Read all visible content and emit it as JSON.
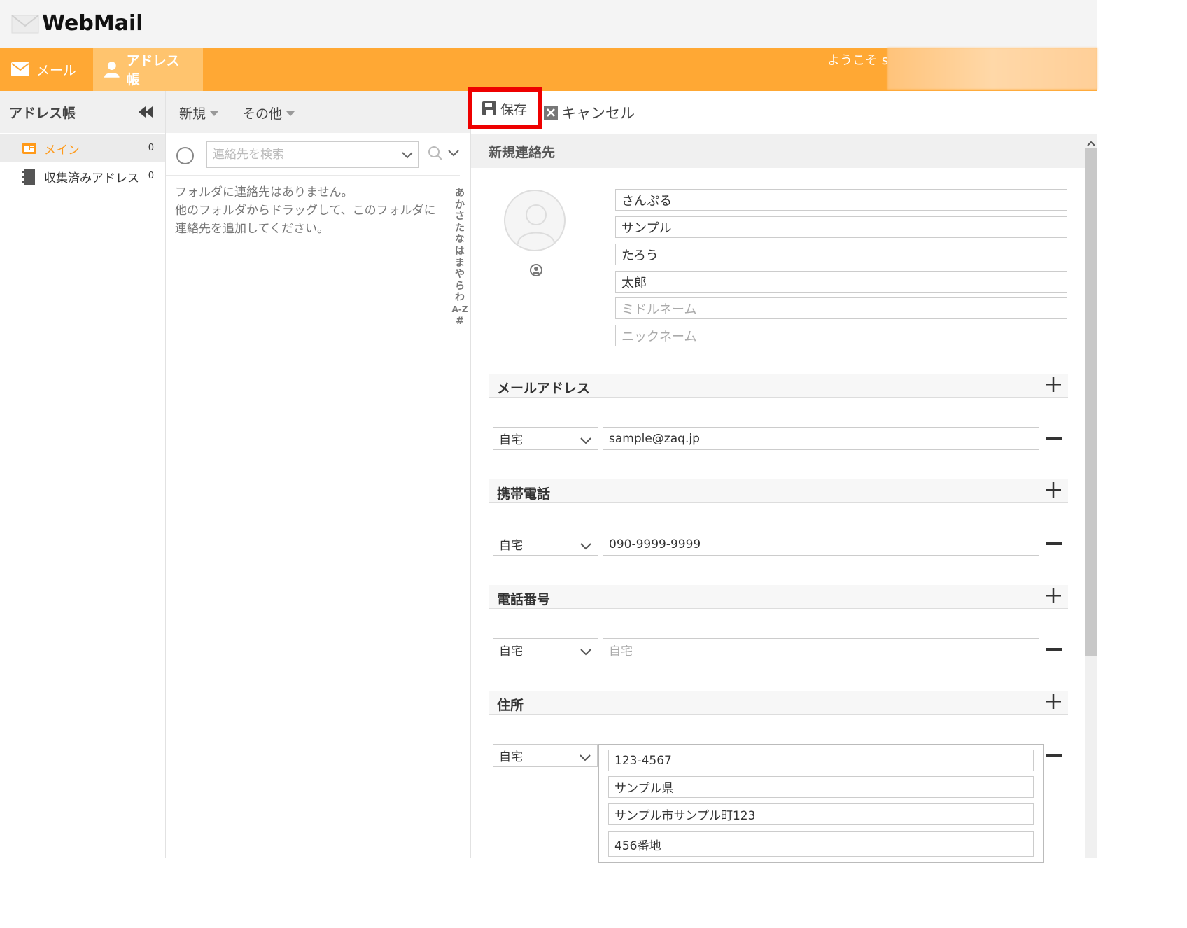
{
  "app": {
    "title": "WebMail"
  },
  "nav": {
    "mail_label": "メール",
    "addressbook_label": "アドレス帳",
    "welcome": "ようこそ s"
  },
  "sidebar": {
    "header": "アドレス帳",
    "folders": [
      {
        "label": "メイン",
        "count": "0"
      },
      {
        "label": "収集済みアドレス",
        "count": "0"
      }
    ]
  },
  "list": {
    "new_label": "新規",
    "other_label": "その他",
    "search_placeholder": "連絡先を検索",
    "empty_lines": [
      "フォルダに連絡先はありません。",
      "他のフォルダからドラッグして、このフォルダに",
      "連絡先を追加してください。"
    ],
    "index": [
      "あ",
      "か",
      "さ",
      "た",
      "な",
      "は",
      "ま",
      "や",
      "ら",
      "わ",
      "A-Z",
      "#"
    ]
  },
  "editor": {
    "save_label": "保存",
    "cancel_label": "キャンセル",
    "header": "新規連絡先",
    "names": [
      {
        "value": "さんぷる"
      },
      {
        "value": "サンプル"
      },
      {
        "value": "たろう"
      },
      {
        "value": "太郎"
      },
      {
        "placeholder": "ミドルネーム"
      },
      {
        "placeholder": "ニックネーム"
      }
    ],
    "sections": {
      "email": {
        "title": "メールアドレス",
        "type": "自宅",
        "value": "sample@zaq.jp"
      },
      "mobile": {
        "title": "携帯電話",
        "type": "自宅",
        "value": "090-9999-9999"
      },
      "phone": {
        "title": "電話番号",
        "type": "自宅",
        "placeholder": "自宅"
      },
      "address": {
        "title": "住所",
        "type": "自宅",
        "lines": [
          "123-4567",
          "サンプル県",
          "サンプル市サンプル町123",
          "456番地"
        ]
      }
    }
  },
  "colors": {
    "accent": "#ffa834",
    "highlight": "#e00000",
    "active_folder": "#ff9a1a"
  }
}
